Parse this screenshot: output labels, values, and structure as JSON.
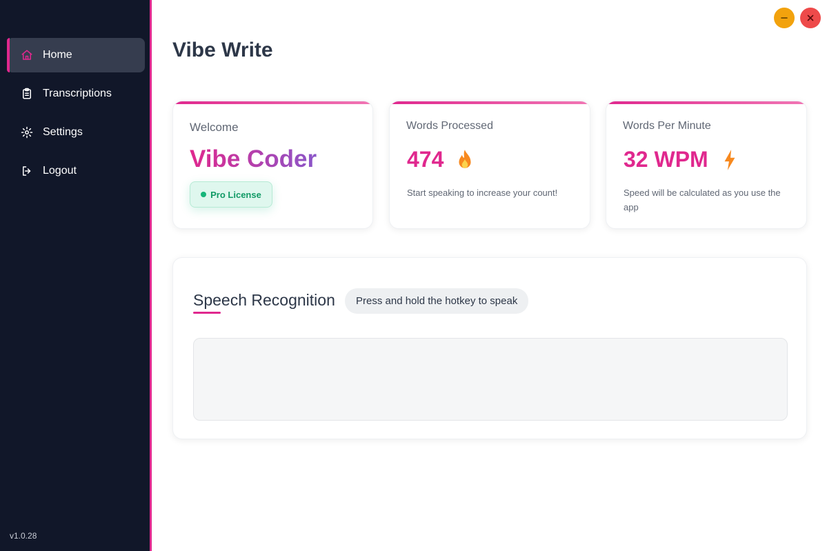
{
  "app_title": "Vibe Write",
  "sidebar": {
    "items": [
      {
        "label": "Home",
        "icon": "home-icon",
        "active": true
      },
      {
        "label": "Transcriptions",
        "icon": "clipboard-icon",
        "active": false
      },
      {
        "label": "Settings",
        "icon": "gear-icon",
        "active": false
      },
      {
        "label": "Logout",
        "icon": "logout-icon",
        "active": false
      }
    ],
    "version": "v1.0.28"
  },
  "window_controls": {
    "minimize_icon": "minimize-icon",
    "close_icon": "close-icon"
  },
  "welcome_card": {
    "label": "Welcome",
    "username": "Vibe Coder",
    "license": "Pro License"
  },
  "words_card": {
    "label": "Words Processed",
    "value": "474",
    "icon": "fire-icon",
    "hint": "Start speaking to increase your count!"
  },
  "wpm_card": {
    "label": "Words Per Minute",
    "value": "32 WPM",
    "icon": "lightning-icon",
    "hint": "Speed will be calculated as you use the app"
  },
  "speech": {
    "title": "Speech Recognition",
    "hotkey_hint": "Press and hold the hotkey to speak",
    "transcript": ""
  },
  "colors": {
    "accent": "#e0288e",
    "sidebar_bg": "#111729",
    "license_green": "#17b57a",
    "minimize": "#f2a20d",
    "close": "#ee4a4a"
  }
}
